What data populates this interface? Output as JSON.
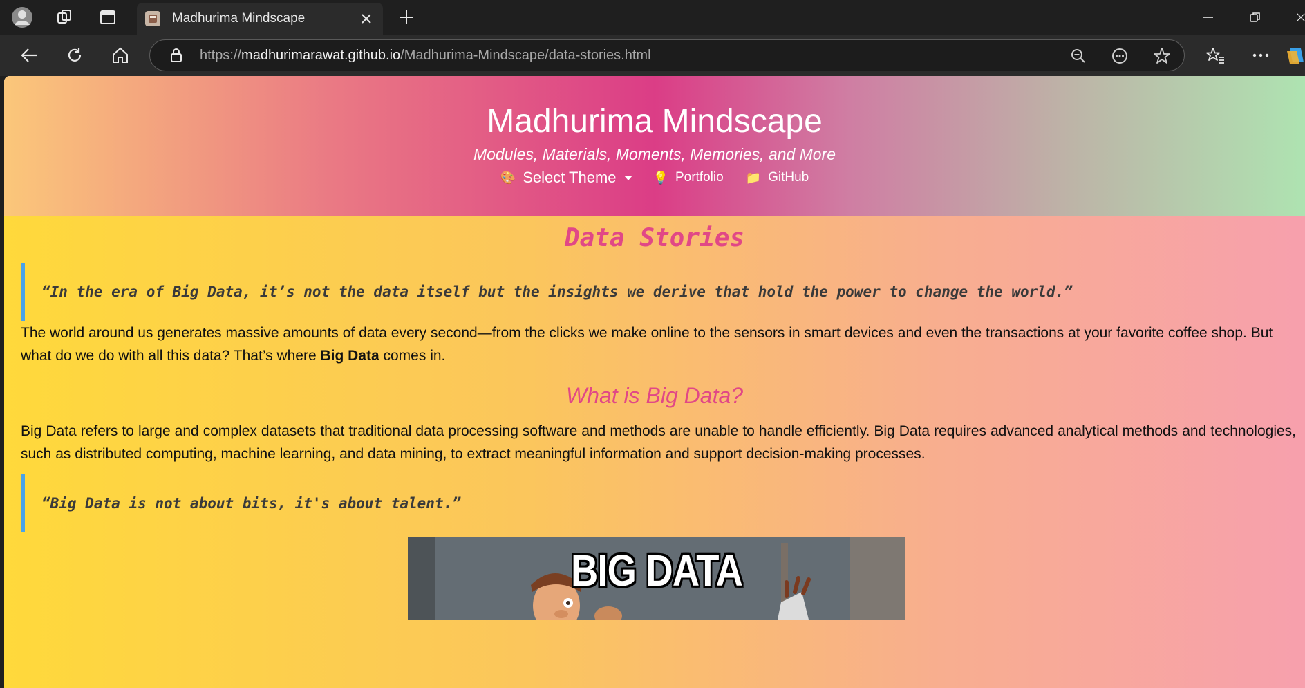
{
  "browser": {
    "tab": {
      "title": "Madhurima Mindscape"
    },
    "url": {
      "scheme": "https://",
      "host": "madhurimarawat.github.io",
      "path": "/Madhurima-Mindscape/data-stories.html"
    }
  },
  "site": {
    "title": "Madhurima Mindscape",
    "subtitle": "Modules, Materials, Moments, Memories, and More",
    "nav": {
      "theme_icon": "🎨",
      "theme_label": "Select Theme",
      "portfolio_icon": "💡",
      "portfolio_label": "Portfolio",
      "github_icon": "📁",
      "github_label": "GitHub"
    }
  },
  "article": {
    "heading": "Data Stories",
    "quote1": "“In the era of Big Data, it’s not the data itself but the insights we derive that hold the power to change the world.”",
    "intro_part1": "The world around us generates massive amounts of data every second—from the clicks we make online to the sensors in smart devices and even the transactions at your favorite coffee shop. But what do we do with all this data? That’s where ",
    "intro_bold": "Big Data",
    "intro_part2": " comes in.",
    "section_heading": "What is Big Data?",
    "section_text": "Big Data refers to large and complex datasets that traditional data processing software and methods are unable to handle efficiently. Big Data requires advanced analytical methods and technologies, such as distributed computing, machine learning, and data mining, to extract meaningful information and support decision-making processes.",
    "quote2": "“Big Data is not about bits, it's about talent.”",
    "meme_caption": "BIG DATA"
  }
}
